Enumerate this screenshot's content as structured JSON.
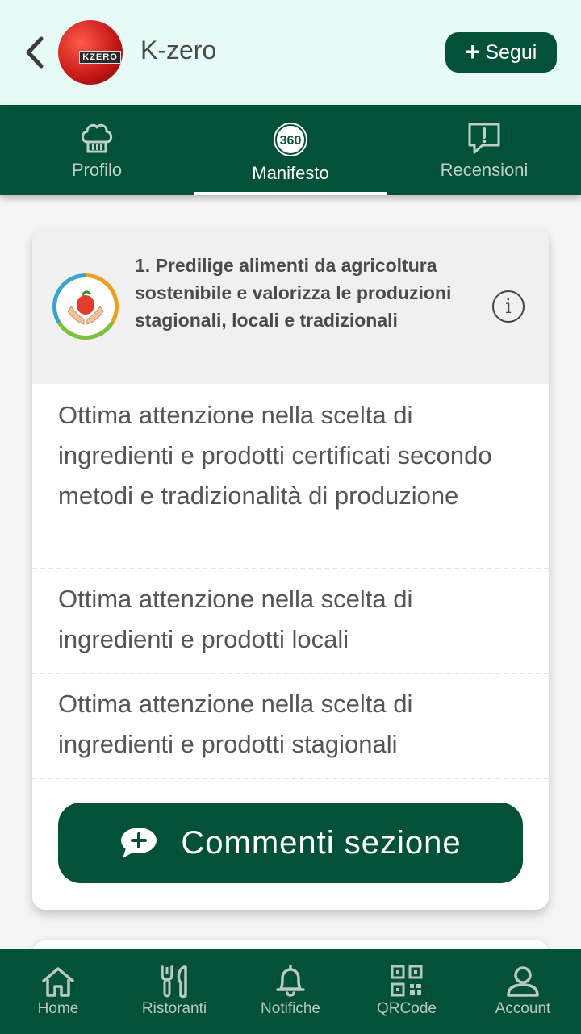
{
  "header": {
    "title": "K-zero",
    "avatar_text": "KZERO",
    "follow_label": "Segui"
  },
  "tabs": [
    {
      "label": "Profilo",
      "icon": "chef-hat-icon"
    },
    {
      "label": "Manifesto",
      "icon": "manifesto-360-icon",
      "active": true
    },
    {
      "label": "Recensioni",
      "icon": "review-alert-icon"
    }
  ],
  "tab_logo_text": "360",
  "section": {
    "title": "1. Predilige alimenti da agricoltura sostenibile e valorizza le produzioni stagionali, locali e tradizionali",
    "items": [
      "Ottima attenzione nella scelta di ingredienti e prodotti certificati secondo metodi e tradizionalità di produzione",
      "Ottima attenzione nella scelta di ingredienti e prodotti locali",
      "Ottima attenzione nella scelta di ingredienti e prodotti stagionali"
    ],
    "comments_label": "Commenti sezione"
  },
  "bottom_nav": [
    {
      "label": "Home",
      "icon": "home-icon"
    },
    {
      "label": "Ristoranti",
      "icon": "cutlery-icon"
    },
    {
      "label": "Notifiche",
      "icon": "bell-icon"
    },
    {
      "label": "QRCode",
      "icon": "qrcode-icon"
    },
    {
      "label": "Account",
      "icon": "user-icon"
    }
  ],
  "colors": {
    "primary": "#035138",
    "header_bg": "#e6fbf6",
    "card_head_bg": "#f0f0f0",
    "text": "#555555"
  }
}
